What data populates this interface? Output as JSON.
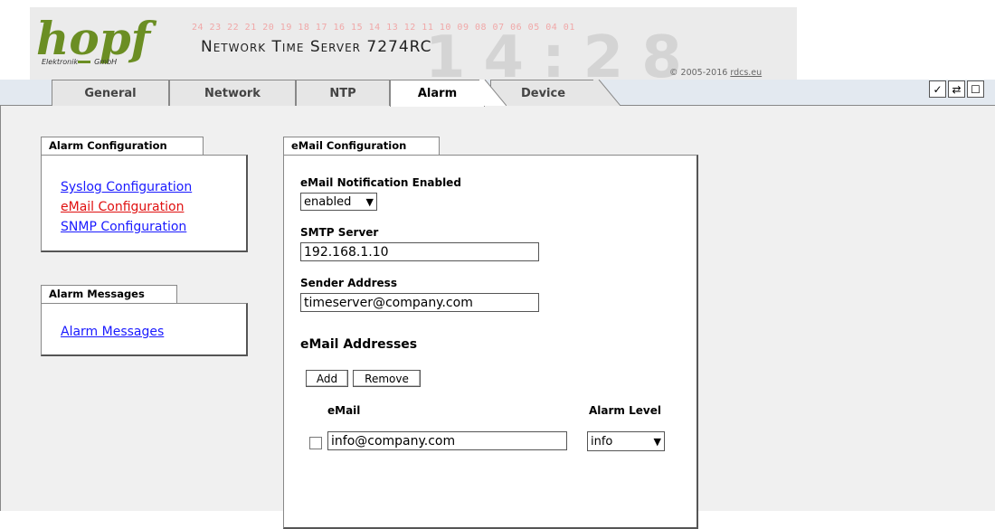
{
  "header": {
    "logo_text": "hopf",
    "logo_sub_left": "Elektronik",
    "logo_sub_right": "GmbH",
    "digit_strip": "24 23 22 21 20 19 18 17 16 15 14 13 12 11 10 09 08 07 06 05 04 01",
    "big_time": "14:28",
    "product_title": "Network Time Server 7274RC",
    "copyright_prefix": "© 2005-2016 ",
    "copyright_link": "rdcs.eu",
    "brand_color": "#6b8e23"
  },
  "tabs": [
    {
      "label": "General",
      "active": false
    },
    {
      "label": "Network",
      "active": false
    },
    {
      "label": "NTP",
      "active": false
    },
    {
      "label": "Alarm",
      "active": true
    },
    {
      "label": "Device",
      "active": false
    }
  ],
  "toolbar": {
    "icons": [
      "check-icon",
      "reload-icon",
      "page-icon"
    ],
    "glyphs": [
      "✓",
      "⇄",
      "☐"
    ]
  },
  "alarm_configuration": {
    "title": "Alarm Configuration",
    "links": [
      {
        "label": "Syslog Configuration",
        "active": false
      },
      {
        "label": "eMail Configuration",
        "active": true
      },
      {
        "label": "SNMP Configuration",
        "active": false
      }
    ]
  },
  "alarm_messages": {
    "title": "Alarm Messages",
    "links": [
      {
        "label": "Alarm Messages",
        "active": false
      }
    ]
  },
  "email_configuration": {
    "title": "eMail Configuration",
    "notification_label": "eMail Notification Enabled",
    "notification_value": "enabled",
    "smtp_label": "SMTP Server",
    "smtp_value": "192.168.1.10",
    "sender_label": "Sender Address",
    "sender_value": "timeserver@company.com",
    "addresses_heading": "eMail Addresses",
    "add_button": "Add",
    "remove_button": "Remove",
    "col_email": "eMail",
    "col_alarm_level": "Alarm Level",
    "rows": [
      {
        "email": "info@company.com",
        "level": "info",
        "checked": false
      }
    ]
  },
  "colors": {
    "link": "#1a1aff",
    "active_link": "#e01010",
    "content_bg": "#f0f0f0"
  }
}
